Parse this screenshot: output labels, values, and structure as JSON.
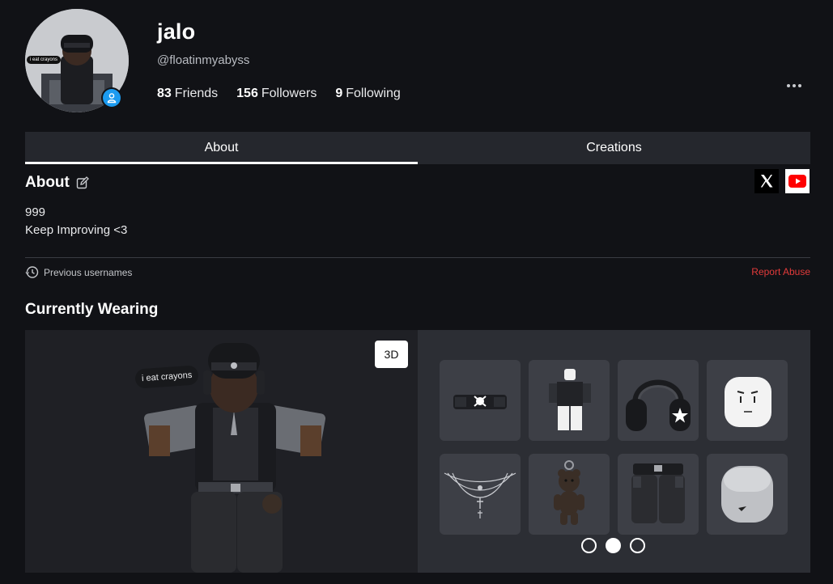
{
  "profile": {
    "display_name": "jalo",
    "username": "@floatinmyabyss",
    "avatar_caption": "i eat crayons",
    "stats": [
      {
        "count": "83",
        "label": "Friends"
      },
      {
        "count": "156",
        "label": "Followers"
      },
      {
        "count": "9",
        "label": "Following"
      }
    ]
  },
  "tabs": [
    {
      "label": "About",
      "active": true
    },
    {
      "label": "Creations",
      "active": false
    }
  ],
  "about": {
    "title": "About",
    "lines": [
      "999",
      "Keep Improving <3"
    ],
    "social": [
      "x-icon",
      "youtube-icon"
    ]
  },
  "footer": {
    "previous_usernames": "Previous usernames",
    "report_abuse": "Report Abuse"
  },
  "wearing": {
    "title": "Currently Wearing",
    "viewer_caption": "i eat crayons",
    "toggle_3d": "3D",
    "items": [
      "bandage-accessory",
      "shirt-outfit",
      "headphones",
      "face-head",
      "chain-necklace",
      "bear-keychain",
      "black-pants",
      "face-head-2"
    ],
    "page_count": 3,
    "active_page": 2
  },
  "colors": {
    "background": "#111216",
    "tab_bar": "#25272d",
    "panel": "#2c2e34",
    "item_tile": "#3d3f46",
    "report": "#e23a3a",
    "online": "#1c9bf0"
  }
}
